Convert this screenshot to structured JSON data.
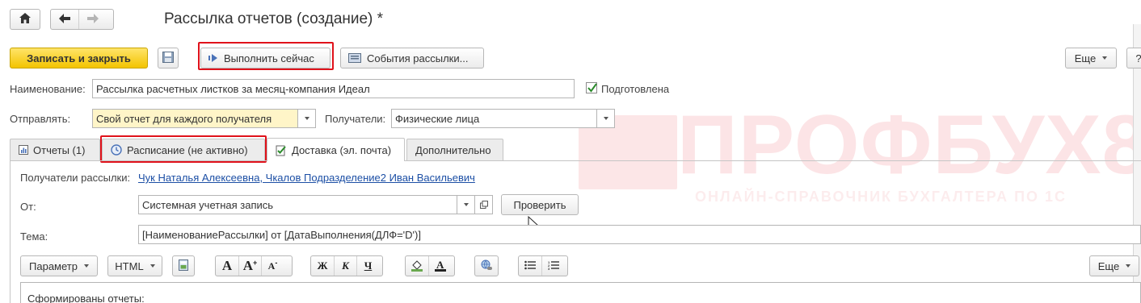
{
  "watermark": {
    "text": "ПРОФБУХ8",
    "subtext": "ОНЛАЙН-СПРАВОЧНИК БУХГАЛТЕРА ПО 1С"
  },
  "header": {
    "title": "Рассылка отчетов (создание) *",
    "home_icon": "home-icon",
    "back_icon": "arrow-left-icon",
    "forward_icon": "arrow-right-icon"
  },
  "toolbar": {
    "save_close_label": "Записать и закрыть",
    "save_icon": "floppy-disk-icon",
    "run_now_label": "Выполнить сейчас",
    "events_label": "События рассылки...",
    "more_label": "Еще",
    "help_label": "?"
  },
  "form": {
    "name_label": "Наименование:",
    "name_value": "Рассылка расчетных листков за месяц-компания Идеал",
    "prepared_label": "Подготовлена",
    "prepared_checked": true,
    "send_label": "Отправлять:",
    "send_value": "Свой отчет для каждого получателя",
    "recipients_label": "Получатели:",
    "recipients_value": "Физические лица"
  },
  "tabs": [
    {
      "label": "Отчеты (1)",
      "icon": "report-icon"
    },
    {
      "label": "Расписание (не активно)",
      "icon": "clock-icon"
    },
    {
      "label": "Доставка (эл. почта)",
      "icon": "delivery-icon",
      "active": true
    },
    {
      "label": "Дополнительно"
    }
  ],
  "delivery": {
    "mailing_recipients_label": "Получатели рассылки:",
    "mailing_recipients_value": "Чук Наталья Алексеевна, Чкалов  Подразделение2 Иван Васильевич",
    "from_label": "От:",
    "from_value": "Системная учетная запись",
    "check_label": "Проверить",
    "subject_label": "Тема:",
    "subject_value": "[НаименованиеРассылки] от [ДатаВыполнения(ДЛФ='D')]"
  },
  "editor": {
    "param_label": "Параметр",
    "html_label": "HTML",
    "bold_label": "Ж",
    "italic_label": "К",
    "underline_label": "Ч",
    "more_label": "Еще",
    "body_text": "Сформированы отчеты:"
  },
  "colors": {
    "primary_button": "#f3c400",
    "highlight_outline": "#e0121b",
    "link": "#1c4fa5",
    "required_field": "#fff5c8"
  }
}
